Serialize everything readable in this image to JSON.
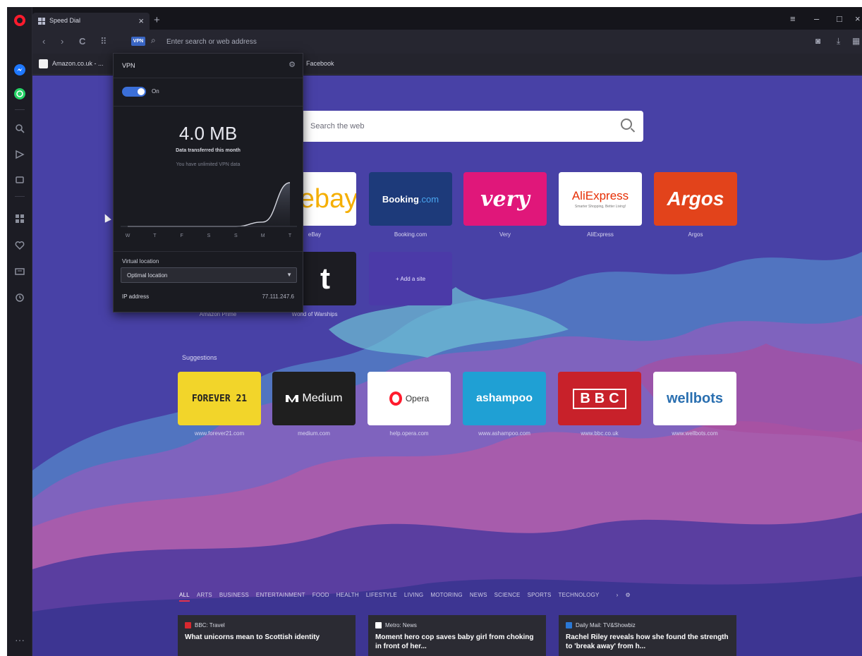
{
  "tab": {
    "title": "Speed Dial",
    "close": "×",
    "new_tab": "+"
  },
  "window_controls": {
    "menu": "≡",
    "minimize": "–",
    "maximize": "□",
    "close": "×"
  },
  "address_bar": {
    "placeholder": "Enter search or web address",
    "back": "‹",
    "forward": "›",
    "reload": "C",
    "speed_dial": "⠿",
    "vpn_badge": "VPN"
  },
  "bookmarks": [
    {
      "label": "Amazon.co.uk - ..."
    },
    {
      "label": "Facebook"
    }
  ],
  "search": {
    "placeholder": "Search the web"
  },
  "vpn": {
    "title": "VPN",
    "toggle_label": "On",
    "toggle_on": true,
    "data_amount": "4.0 MB",
    "data_label": "Data transferred this month",
    "unlimited_note": "You have unlimited VPN data",
    "chart_days": [
      "W",
      "T",
      "F",
      "S",
      "S",
      "M",
      "T"
    ],
    "chart_values": [
      0,
      0,
      0,
      0,
      0,
      0.1,
      1
    ],
    "location_label": "Virtual location",
    "location_value": "Optimal location",
    "ip_label": "IP address",
    "ip_value": "77.111.247.6"
  },
  "speed_dial": [
    {
      "name": "ebay",
      "label": "ebay",
      "caption": "eBay",
      "bg": "#ffffff",
      "fg": "#e53238"
    },
    {
      "name": "booking",
      "label": "Booking",
      "label2": ".com",
      "caption": "Booking.com",
      "bg": "#1d3a7a",
      "fg": "#ffffff"
    },
    {
      "name": "very",
      "label": "very",
      "caption": "Very",
      "bg": "#e0177a",
      "fg": "#ffffff"
    },
    {
      "name": "aliexpress",
      "label": "AliExpress",
      "sub": "Smarter Shopping, Better Living!",
      "caption": "AliExpress",
      "bg": "#ffffff",
      "fg": "#e62e04"
    },
    {
      "name": "argos",
      "label": "Argos",
      "caption": "Argos",
      "bg": "#e2431b",
      "fg": "#ffffff"
    },
    {
      "name": "amazon-prime",
      "label": "",
      "caption": "Amazon Prime",
      "bg": "#2a2d35",
      "fg": "#ffffff"
    },
    {
      "name": "world-of-warships",
      "label": "t",
      "caption": "World of Warships",
      "bg": "#1c1c22",
      "fg": "#ffffff"
    },
    {
      "name": "add-site",
      "label": "+ Add a site",
      "caption": "",
      "bg": "#4b3aa8",
      "fg": "#ffffff"
    }
  ],
  "suggestions_label": "Suggestions",
  "suggestions": [
    {
      "name": "forever21",
      "label": "FOREVER 21",
      "caption": "www.forever21.com",
      "bg": "#f2d52a",
      "fg": "#222222"
    },
    {
      "name": "medium",
      "label": "Medium",
      "caption": "medium.com",
      "bg": "#1f1f1f",
      "fg": "#ffffff"
    },
    {
      "name": "opera",
      "label": "Opera",
      "caption": "help.opera.com",
      "bg": "#ffffff",
      "fg": "#222222"
    },
    {
      "name": "ashampoo",
      "label": "ashampoo",
      "caption": "www.ashampoo.com",
      "bg": "#1fa0d4",
      "fg": "#ffffff"
    },
    {
      "name": "bbc",
      "label": "BBC",
      "caption": "www.bbc.co.uk",
      "bg": "#c8212a",
      "fg": "#ffffff"
    },
    {
      "name": "wellbots",
      "label": "wellbots",
      "caption": "www.wellbots.com",
      "bg": "#ffffff",
      "fg": "#2a6fb0"
    }
  ],
  "news_categories": [
    "ALL",
    "ARTS",
    "BUSINESS",
    "ENTERTAINMENT",
    "FOOD",
    "HEALTH",
    "LIFESTYLE",
    "LIVING",
    "MOTORING",
    "NEWS",
    "SCIENCE",
    "SPORTS",
    "TECHNOLOGY"
  ],
  "news": [
    {
      "source": "BBC: Travel",
      "src_color": "#d8282f",
      "headline": "What unicorns mean to Scottish identity"
    },
    {
      "source": "Metro: News",
      "src_color": "#ffffff",
      "headline": "Moment hero cop saves baby girl from choking in front of her..."
    },
    {
      "source": "Daily Mail: TV&Showbiz",
      "src_color": "#2a78d6",
      "headline": "Rachel Riley reveals how she found the strength to 'break away' from h..."
    }
  ],
  "sidebar": {
    "more": "···"
  }
}
